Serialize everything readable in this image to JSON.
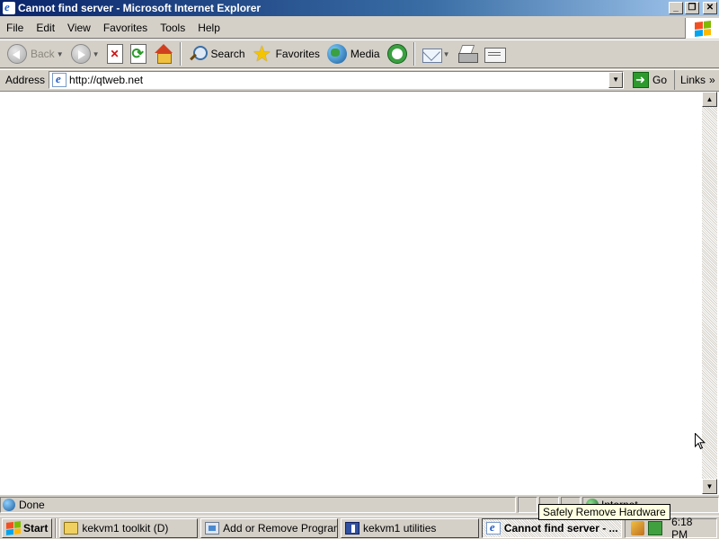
{
  "window": {
    "title": "Cannot find server - Microsoft Internet Explorer",
    "controls": {
      "minimize": "_",
      "restore": "❐",
      "close": "✕"
    }
  },
  "menu": {
    "items": [
      "File",
      "Edit",
      "View",
      "Favorites",
      "Tools",
      "Help"
    ]
  },
  "toolbar": {
    "back_label": "Back",
    "search_label": "Search",
    "favorites_label": "Favorites",
    "media_label": "Media"
  },
  "address": {
    "label": "Address",
    "url": "http://qtweb.net",
    "go_label": "Go",
    "links_label": "Links",
    "links_chevron": "»"
  },
  "status": {
    "text": "Done",
    "zone_text": "Internet"
  },
  "tooltip": {
    "text": "Safely Remove Hardware"
  },
  "taskbar": {
    "start_label": "Start",
    "tasks": [
      {
        "label": "kekvm1 toolkit (D)",
        "icon": "folder-icon",
        "active": false
      },
      {
        "label": "Add or Remove Programs",
        "icon": "add-remove-programs-icon",
        "active": false
      },
      {
        "label": "kekvm1 utilities",
        "icon": "utilities-icon",
        "active": false
      },
      {
        "label": "Cannot find server - ...",
        "icon": "internet-explorer-icon",
        "active": true
      }
    ],
    "clock": "6:18 PM"
  },
  "colors": {
    "titlebar_start": "#0a246a",
    "titlebar_end": "#a6caf0",
    "chrome": "#d4d0c8",
    "tooltip_bg": "#ffffe1"
  }
}
